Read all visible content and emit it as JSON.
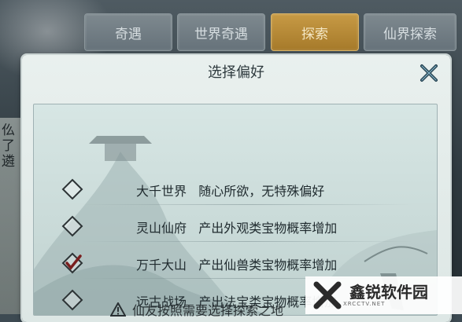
{
  "tabs": [
    {
      "label": "奇遇",
      "active": false
    },
    {
      "label": "世界奇遇",
      "active": false
    },
    {
      "label": "探索",
      "active": true
    },
    {
      "label": "仙界探索",
      "active": false
    }
  ],
  "background": {
    "left_text": "仫了遴"
  },
  "dialog": {
    "title": "选择偏好",
    "options": [
      {
        "text": "大千世界   随心所欲，无特殊偏好",
        "checked": false
      },
      {
        "text": "灵山仙府   产出外观类宝物概率增加",
        "checked": false
      },
      {
        "text": "万千大山   产出仙兽类宝物概率增加",
        "checked": true
      },
      {
        "text": "远古战场   产出法宝类宝物概率增加",
        "checked": false
      }
    ],
    "warning_text": "仙友按照需要选择探索之地"
  },
  "watermark": {
    "name": "鑫锐软件园",
    "url": "XRCCTV.NET"
  },
  "colors": {
    "active_tab": "#c79a45",
    "dialog_bg": "#e9f0ee",
    "check_mark": "#7a1f1f"
  }
}
